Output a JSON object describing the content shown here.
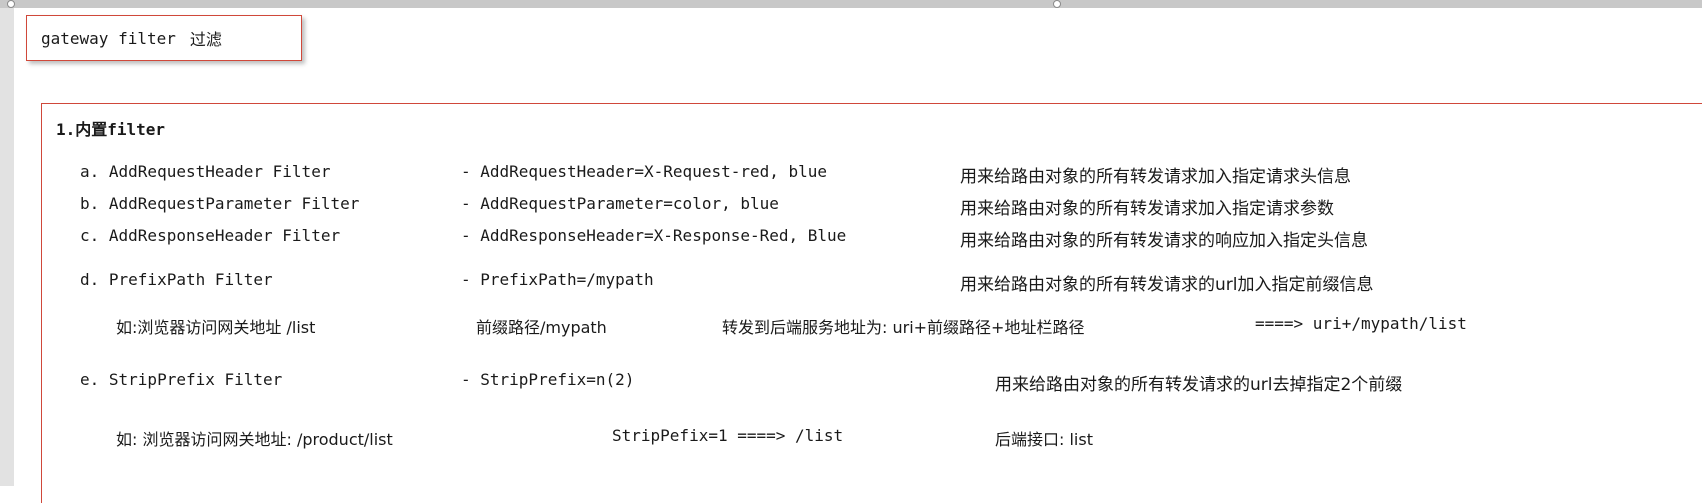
{
  "header": {
    "title_en": "gateway filter",
    "title_cn": "过滤"
  },
  "section": {
    "title": "1.内置filter"
  },
  "filters": [
    {
      "name": "a. AddRequestHeader Filter",
      "config": "- AddRequestHeader=X-Request-red, blue",
      "desc": "用来给路由对象的所有转发请求加入指定请求头信息"
    },
    {
      "name": "b. AddRequestParameter Filter",
      "config": "- AddRequestParameter=color, blue",
      "desc": "用来给路由对象的所有转发请求加入指定请求参数"
    },
    {
      "name": "c. AddResponseHeader Filter",
      "config": "- AddResponseHeader=X-Response-Red, Blue",
      "desc": "用来给路由对象的所有转发请求的响应加入指定头信息"
    },
    {
      "name": "d. PrefixPath Filter",
      "config": "- PrefixPath=/mypath",
      "desc": "用来给路由对象的所有转发请求的url加入指定前缀信息"
    },
    {
      "name": "e.  StripPrefix Filter",
      "config": "- StripPrefix=n(2)",
      "desc": "用来给路由对象的所有转发请求的url去掉指定2个前缀"
    }
  ],
  "example_prefix": {
    "part1": "如:浏览器访问网关地址 /list",
    "part2": "前缀路径/mypath",
    "part3": "转发到后端服务地址为: uri+前缀路径+地址栏路径",
    "part4": "====> uri+/mypath/list"
  },
  "example_strip": {
    "part1": "如: 浏览器访问网关地址: /product/list",
    "part2": "StripPefix=1  ====>  /list",
    "part3": "后端接口: list"
  }
}
